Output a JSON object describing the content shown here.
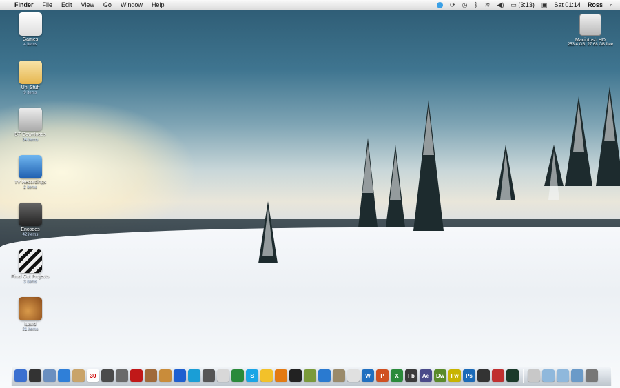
{
  "menubar": {
    "apple": "",
    "app": "Finder",
    "menus": [
      "File",
      "Edit",
      "View",
      "Go",
      "Window",
      "Help"
    ],
    "battery": "(3:13)",
    "clock": "Sat 01:14",
    "user": "Ross"
  },
  "desktop_icons": [
    {
      "name": "Games",
      "sub": "4 items",
      "color": "#ffffff"
    },
    {
      "name": "Uni Stuff",
      "sub": "9 items",
      "color": "#f3d37a"
    },
    {
      "name": "BT Downloads",
      "sub": "34 items",
      "color": "#c8c8c8"
    },
    {
      "name": "TV Recordings",
      "sub": "2 items",
      "color": "#3f8fd8"
    },
    {
      "name": "Encodes",
      "sub": "42 items",
      "color": "#3a3a44"
    },
    {
      "name": "Final Cut Projects",
      "sub": "3 items",
      "color": "#202020"
    },
    {
      "name": "iLand",
      "sub": "21 items",
      "color": "#c98c3a"
    }
  ],
  "hard_drive": {
    "name": "Macintosh HD",
    "sub": "253.4 GB, 27.68 GB free"
  },
  "dock": {
    "apps": [
      {
        "label": "",
        "color": "#3a6fd0"
      },
      {
        "label": "",
        "color": "#333"
      },
      {
        "label": "",
        "color": "#6a8fc0"
      },
      {
        "label": "",
        "color": "#2f7fd8"
      },
      {
        "label": "",
        "color": "#c9a46a"
      },
      {
        "label": "30",
        "color": "#ffffff"
      },
      {
        "label": "",
        "color": "#4b4b4b"
      },
      {
        "label": "",
        "color": "#6a6a6a"
      },
      {
        "label": "",
        "color": "#c01818"
      },
      {
        "label": "",
        "color": "#a06a3a"
      },
      {
        "label": "",
        "color": "#c98c3a"
      },
      {
        "label": "",
        "color": "#1e5fd0"
      },
      {
        "label": "",
        "color": "#1a9ed6"
      },
      {
        "label": "",
        "color": "#555"
      },
      {
        "label": "",
        "color": "#d8d8d8"
      },
      {
        "label": "",
        "color": "#2a8a3a"
      },
      {
        "label": "S",
        "color": "#1aa5e6"
      },
      {
        "label": "",
        "color": "#f2c12a"
      },
      {
        "label": "",
        "color": "#e37a12"
      },
      {
        "label": "",
        "color": "#222"
      },
      {
        "label": "",
        "color": "#7a9a3a"
      },
      {
        "label": "",
        "color": "#2a7ad0"
      },
      {
        "label": "",
        "color": "#9a8a6a"
      },
      {
        "label": "",
        "color": "#e0e0e0"
      },
      {
        "label": "W",
        "color": "#1f6fc0"
      },
      {
        "label": "P",
        "color": "#d05020"
      },
      {
        "label": "X",
        "color": "#2a8a3a"
      },
      {
        "label": "Fb",
        "color": "#3a3a3a"
      },
      {
        "label": "Ae",
        "color": "#4a4a8a"
      },
      {
        "label": "Dw",
        "color": "#5a8a2a"
      },
      {
        "label": "Fw",
        "color": "#c8b400"
      },
      {
        "label": "Ps",
        "color": "#1a6ab8"
      },
      {
        "label": "",
        "color": "#333"
      },
      {
        "label": "",
        "color": "#c03030"
      },
      {
        "label": "",
        "color": "#1a3a2a"
      }
    ],
    "stacks": [
      {
        "label": "",
        "color": "#c8c8c8"
      },
      {
        "label": "",
        "color": "#8fb8dc"
      },
      {
        "label": "",
        "color": "#8fb8dc"
      },
      {
        "label": "",
        "color": "#6a9ac8"
      },
      {
        "label": "",
        "color": "#777"
      }
    ]
  }
}
